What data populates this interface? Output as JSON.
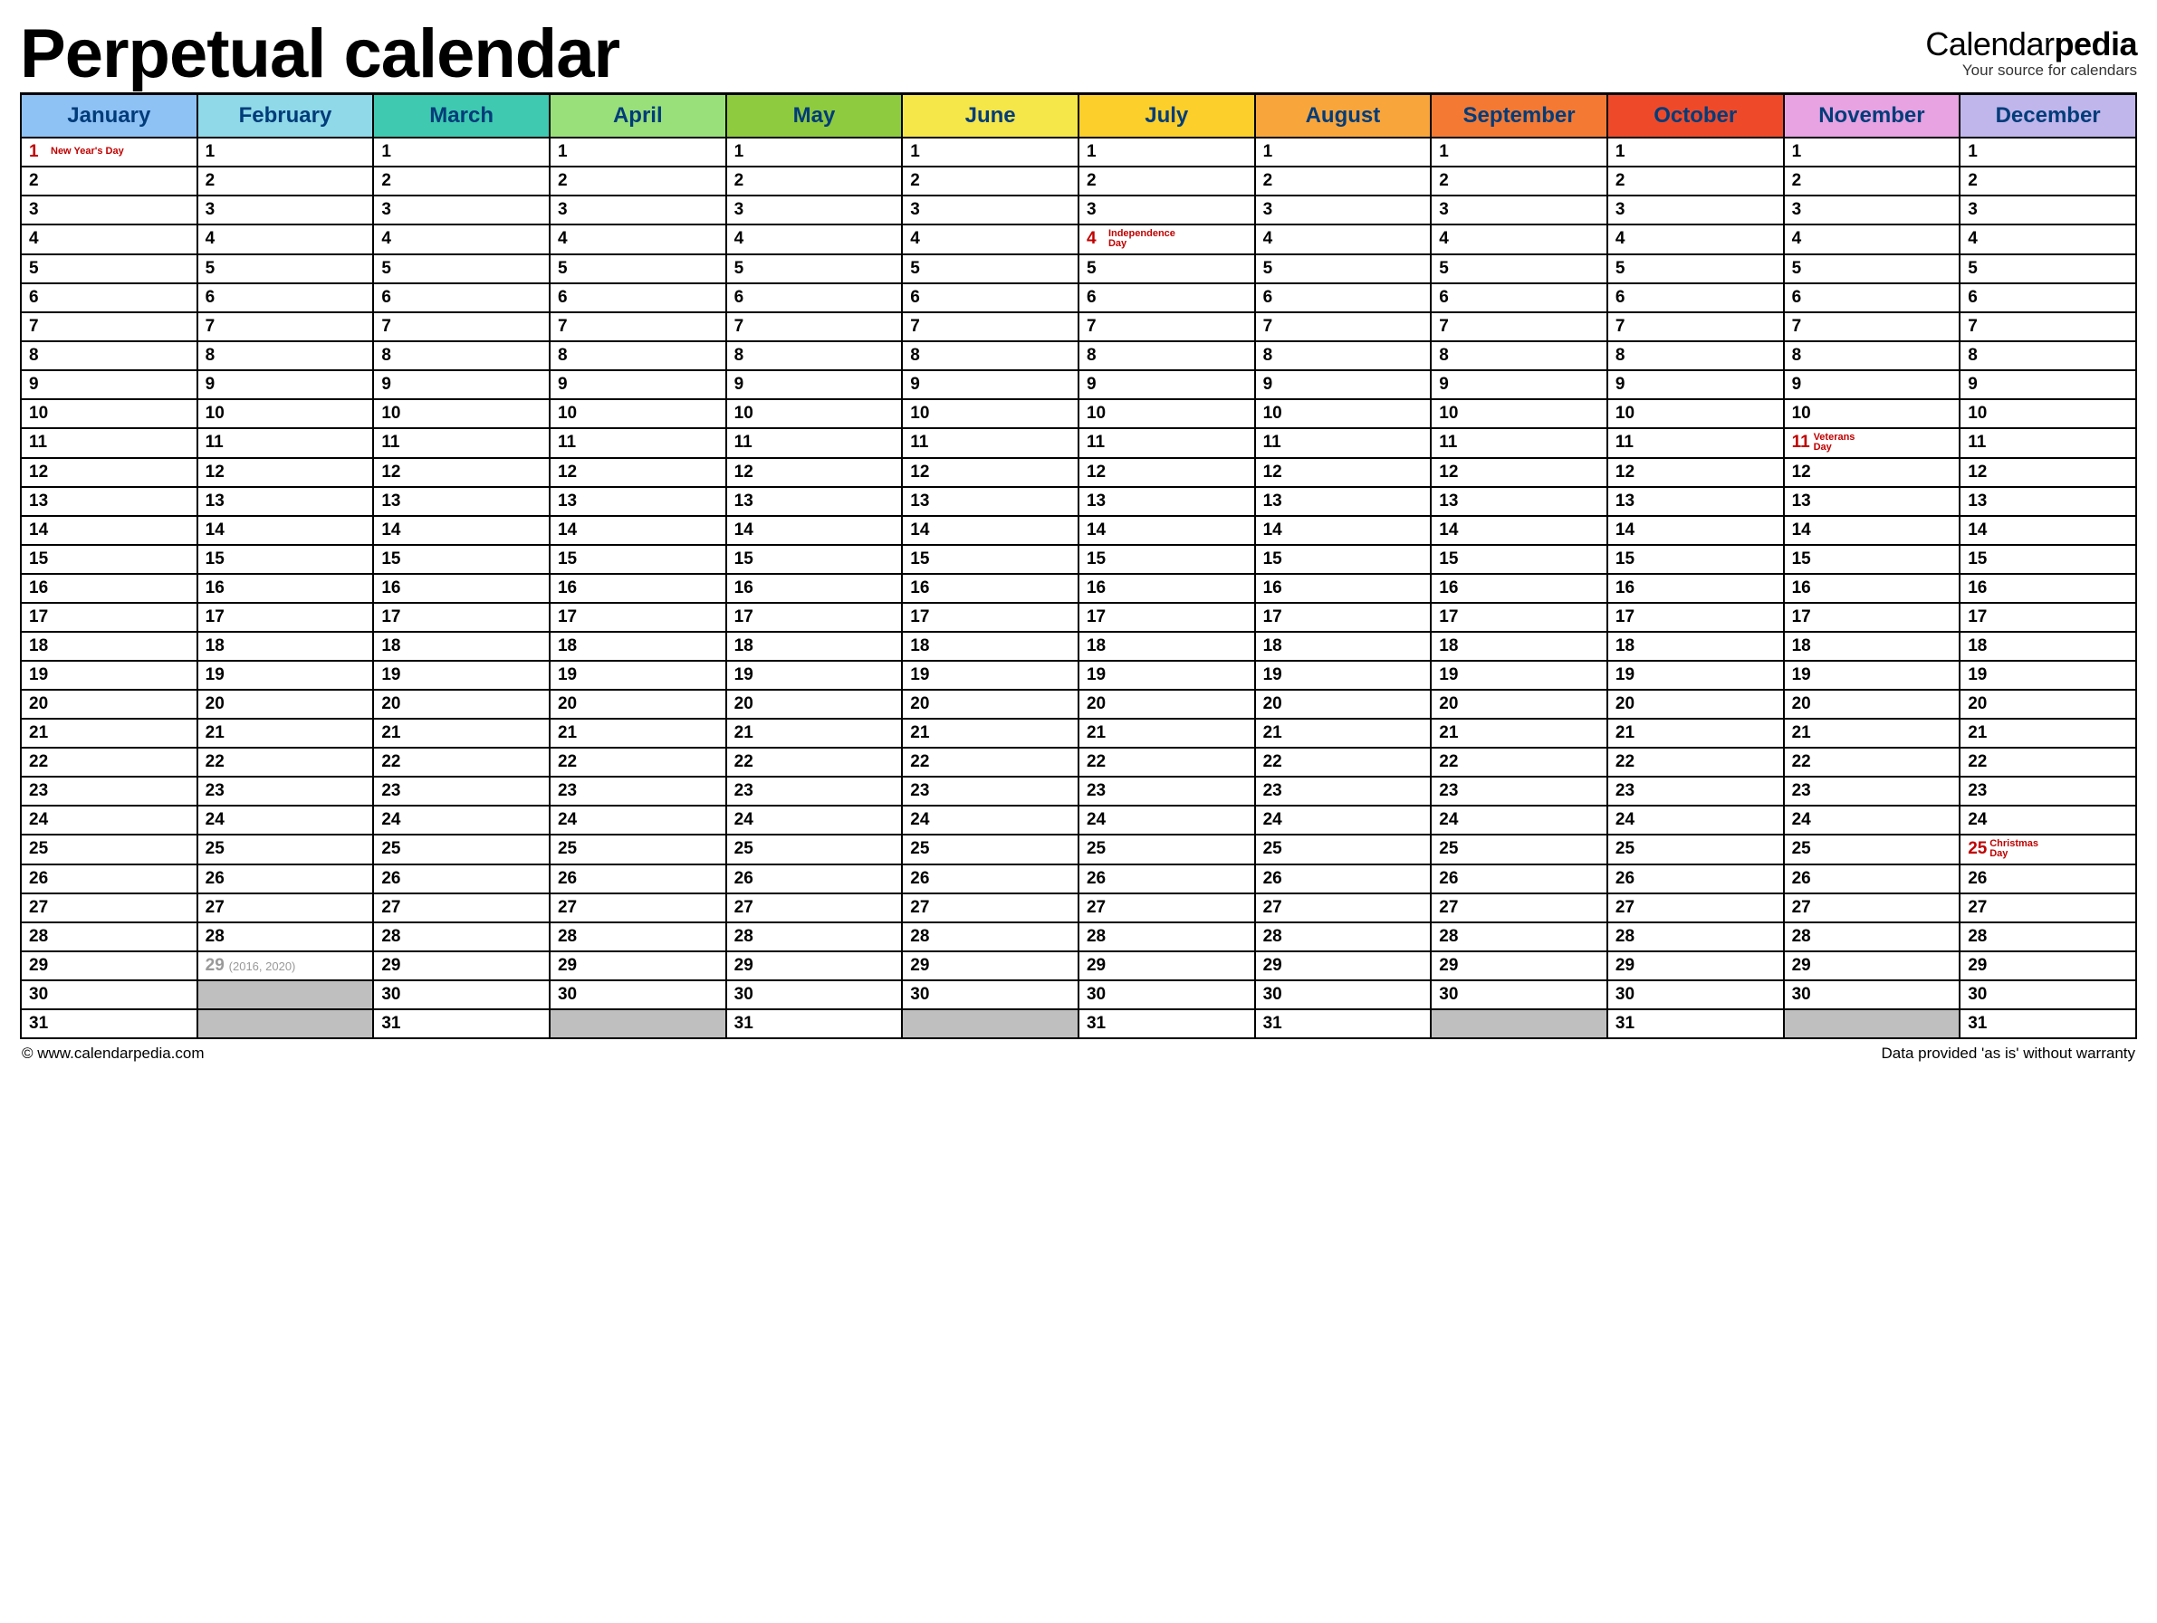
{
  "title": "Perpetual calendar",
  "brand": {
    "name1": "Calendar",
    "name2": "pedia",
    "tagline": "Your source for calendars"
  },
  "footer": {
    "left": "© www.calendarpedia.com",
    "right": "Data provided 'as is' without warranty"
  },
  "months": [
    {
      "name": "January",
      "color": "#8fc2f4",
      "days": 31
    },
    {
      "name": "February",
      "color": "#8fd9e8",
      "days": 28
    },
    {
      "name": "March",
      "color": "#3fc9b0",
      "days": 31
    },
    {
      "name": "April",
      "color": "#99e07a",
      "days": 30
    },
    {
      "name": "May",
      "color": "#8ecb3e",
      "days": 31
    },
    {
      "name": "June",
      "color": "#f5e64a",
      "days": 30
    },
    {
      "name": "July",
      "color": "#fccf2a",
      "days": 31
    },
    {
      "name": "August",
      "color": "#f8a63c",
      "days": 31
    },
    {
      "name": "September",
      "color": "#f47a34",
      "days": 30
    },
    {
      "name": "October",
      "color": "#ee4a2a",
      "days": 31
    },
    {
      "name": "November",
      "color": "#e7a3e2",
      "days": 30
    },
    {
      "name": "December",
      "color": "#c0b6ec",
      "days": 31
    }
  ],
  "holidays": {
    "0-1": "New Year's Day",
    "6-4": "Independence Day",
    "10-11": "Veterans Day",
    "11-25": "Christmas Day"
  },
  "leap": {
    "month": 1,
    "day": 29,
    "note": "(2016, 2020)"
  },
  "max_days": 31
}
